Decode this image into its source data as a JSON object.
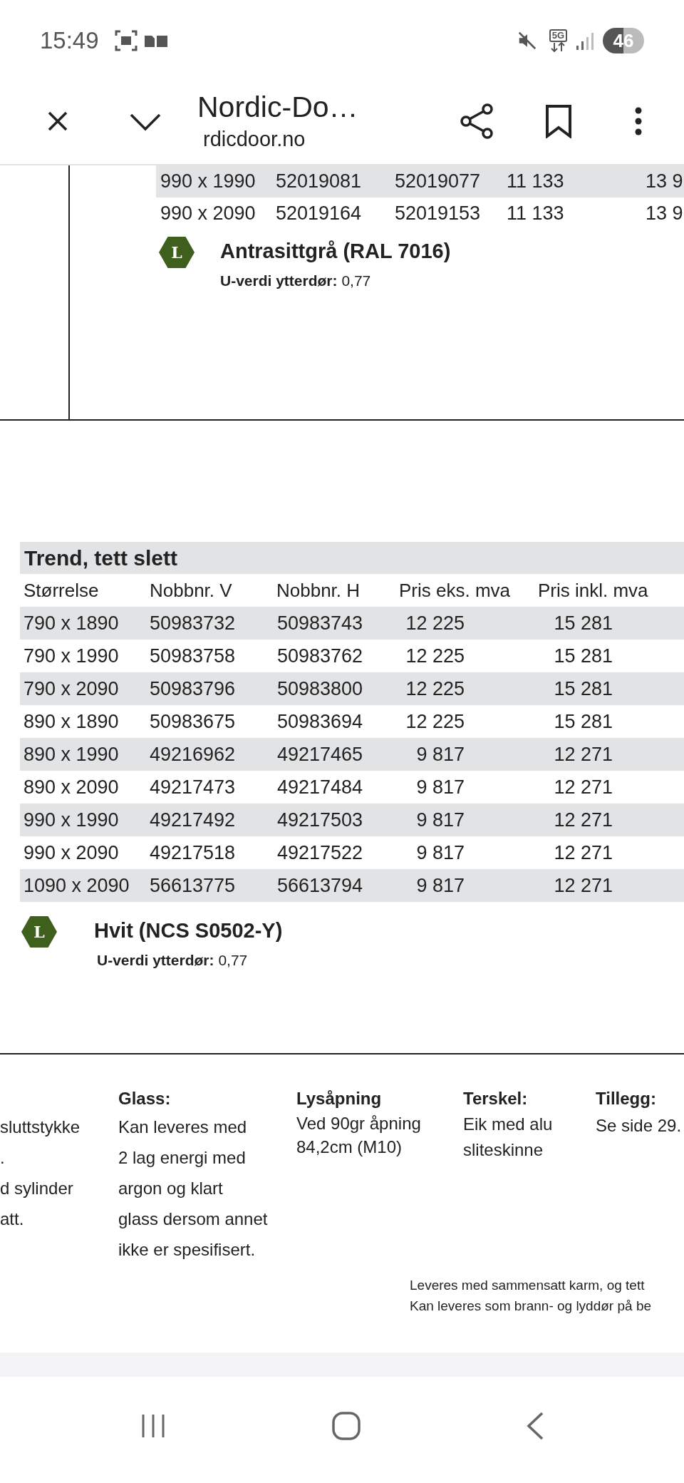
{
  "status_bar": {
    "time": "15:49",
    "network": "5G",
    "battery": "46"
  },
  "browser_bar": {
    "title": "Nordic-Do…",
    "url": "rdicdoor.no"
  },
  "upper_table": {
    "rows": [
      {
        "cells": [
          "990 x 1990",
          "52019081",
          "52019077",
          "11 133",
          "13 9"
        ]
      },
      {
        "cells": [
          "990 x 2090",
          "52019164",
          "52019153",
          "11 133",
          "13 9"
        ]
      }
    ]
  },
  "upper_variant": {
    "badge": "L",
    "name": "Antrasittgrå (RAL 7016)",
    "u_value_label": "U-verdi ytterdør:",
    "u_value": "0,77"
  },
  "lower_table": {
    "title": "Trend, tett slett",
    "columns": [
      "Størrelse",
      "Nobbnr. V",
      "Nobbnr. H",
      "Pris eks. mva",
      "Pris inkl. mva"
    ],
    "rows": [
      {
        "cells": [
          "790 x 1890",
          "50983732",
          "50983743",
          "12 225",
          "15 281"
        ]
      },
      {
        "cells": [
          "790 x 1990",
          "50983758",
          "50983762",
          "12 225",
          "15 281"
        ]
      },
      {
        "cells": [
          "790 x 2090",
          "50983796",
          "50983800",
          "12 225",
          "15 281"
        ]
      },
      {
        "cells": [
          "890 x 1890",
          "50983675",
          "50983694",
          "12 225",
          "15 281"
        ]
      },
      {
        "cells": [
          "890 x 1990",
          "49216962",
          "49217465",
          "9 817",
          "12 271"
        ]
      },
      {
        "cells": [
          "890 x 2090",
          "49217473",
          "49217484",
          "9 817",
          "12 271"
        ]
      },
      {
        "cells": [
          "990 x 1990",
          "49217492",
          "49217503",
          "9 817",
          "12 271"
        ]
      },
      {
        "cells": [
          "990 x 2090",
          "49217518",
          "49217522",
          "9 817",
          "12 271"
        ]
      },
      {
        "cells": [
          "1090 x 2090",
          "56613775",
          "56613794",
          "9 817",
          "12 271"
        ]
      }
    ]
  },
  "lower_variant": {
    "badge": "L",
    "name": "Hvit (NCS S0502-Y)",
    "u_value_label": "U-verdi ytterdør:",
    "u_value": "0,77"
  },
  "specs": [
    {
      "lines": [
        "sluttstykke",
        ".",
        "d sylinder",
        "att."
      ]
    },
    {
      "heading": "Glass:",
      "lines": [
        "Kan leveres med",
        "2 lag energi med",
        "argon og klart",
        "glass dersom annet",
        "ikke er spesifisert."
      ]
    },
    {
      "heading": "Lysåpning",
      "lines": [
        "Ved 90gr åpning",
        "84,2cm (M10)"
      ]
    },
    {
      "heading": "Terskel:",
      "lines": [
        "Eik med alu",
        "sliteskinne"
      ]
    },
    {
      "heading": "Tillegg:",
      "lines": [
        "Se side 29."
      ]
    }
  ],
  "notes": [
    "Leveres med sammensatt karm, og tett",
    "Kan leveres som brann- og lyddør på be"
  ]
}
